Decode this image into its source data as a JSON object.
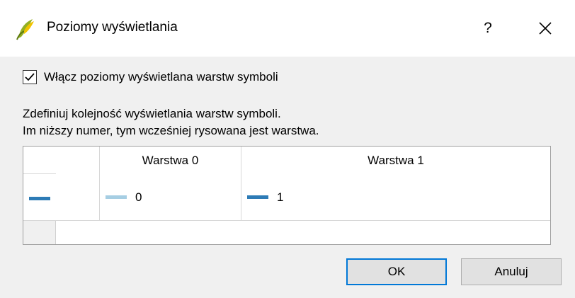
{
  "window": {
    "title": "Poziomy wyświetlania",
    "help_label": "?"
  },
  "options": {
    "enable_label": "Włącz poziomy wyświetlana warstw symboli",
    "enable_checked": true
  },
  "description": {
    "line1": "Zdefiniuj kolejność wyświetlania warstw symboli.",
    "line2": "Im niższy numer, tym wcześniej rysowana jest warstwa."
  },
  "table": {
    "columns": [
      "Warstwa 0",
      "Warstwa 1"
    ],
    "rows": [
      {
        "symbol_color": "#2d7bb6",
        "cells": [
          {
            "value": "0",
            "color": "#a6cee3"
          },
          {
            "value": "1",
            "color": "#2d7bb6"
          }
        ]
      }
    ]
  },
  "buttons": {
    "ok": "OK",
    "cancel": "Anuluj"
  },
  "colors": {
    "accent": "#0078d7",
    "dialog_bg": "#f0f0f0"
  }
}
